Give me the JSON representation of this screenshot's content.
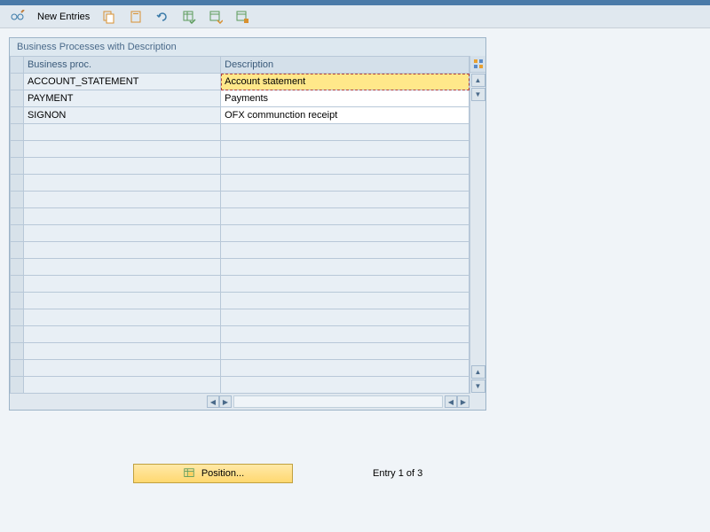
{
  "toolbar": {
    "new_entries_label": "New Entries"
  },
  "panel": {
    "title": "Business Processes with Description"
  },
  "table": {
    "headers": {
      "business_proc": "Business proc.",
      "description": "Description"
    },
    "rows": [
      {
        "proc": "ACCOUNT_STATEMENT",
        "desc": "Account statement"
      },
      {
        "proc": "PAYMENT",
        "desc": "Payments"
      },
      {
        "proc": "SIGNON",
        "desc": "OFX communction receipt"
      }
    ]
  },
  "footer": {
    "position_label": "Position...",
    "entry_text": "Entry 1 of 3"
  },
  "icons": {
    "glasses_pencil": "glasses-pencil-icon",
    "copy": "copy-icon",
    "paste": "paste-icon",
    "undo": "undo-icon",
    "table1": "table-check-icon",
    "table2": "table-arrow-icon",
    "table3": "table-save-icon",
    "grid": "grid-icon",
    "position": "position-icon"
  }
}
